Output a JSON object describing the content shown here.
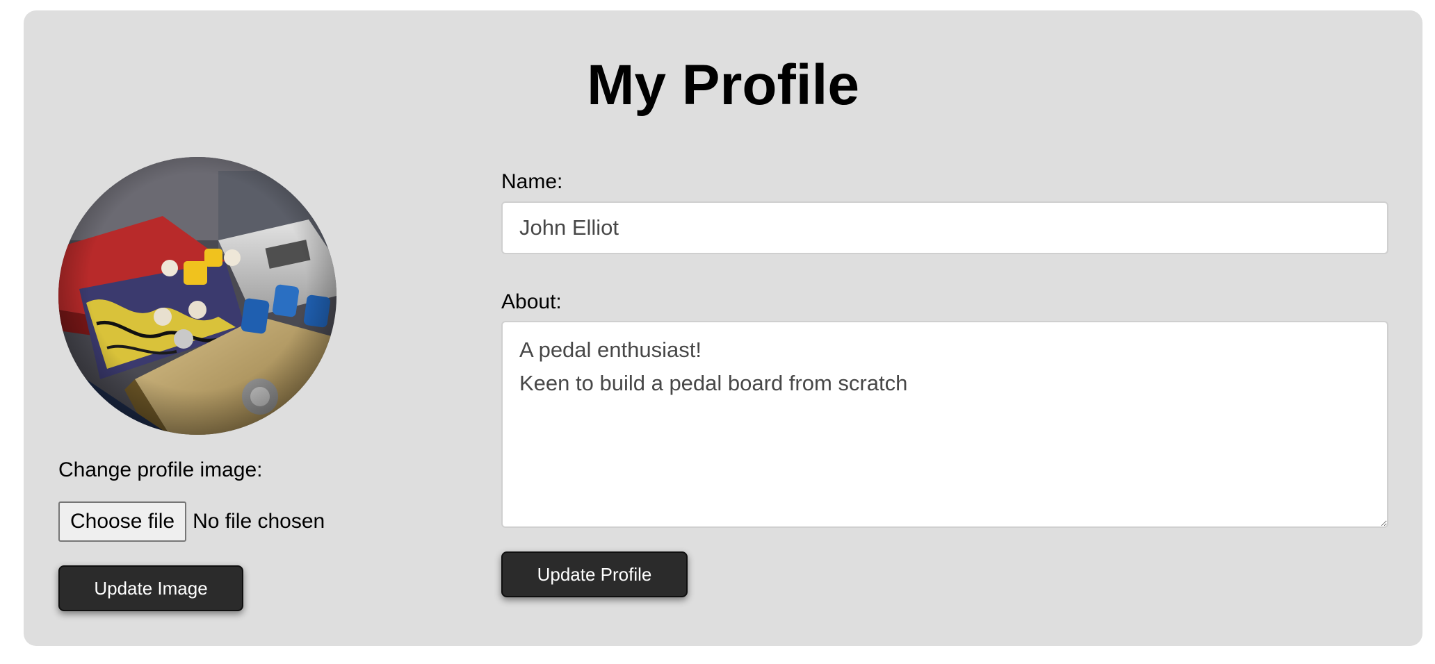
{
  "page": {
    "title": "My Profile"
  },
  "image_panel": {
    "avatar_icon": "guitar-pedals-photo",
    "change_label": "Change profile image:",
    "choose_file_label": "Choose file",
    "no_file_text": "No file chosen",
    "update_image_label": "Update Image"
  },
  "profile_form": {
    "name_label": "Name:",
    "name_value": "John Elliot",
    "about_label": "About:",
    "about_value": "A pedal enthusiast!\nKeen to build a pedal board from scratch",
    "update_profile_label": "Update Profile"
  },
  "colors": {
    "card_background": "#dedede",
    "button_background": "#2b2b2b",
    "button_text": "#ffffff",
    "input_text": "#474747"
  }
}
